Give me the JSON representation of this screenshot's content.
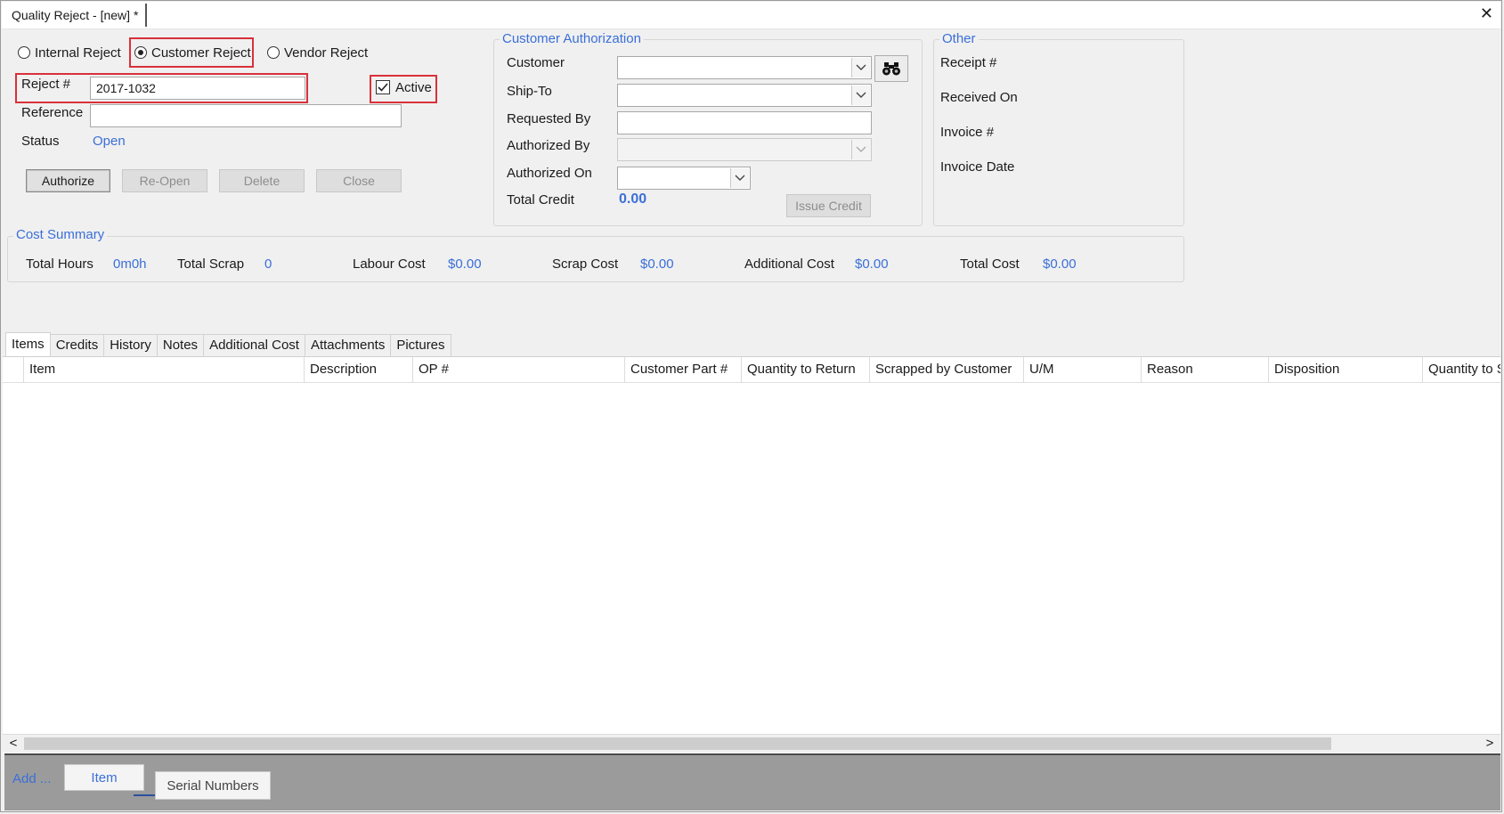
{
  "window": {
    "tab_title": "Quality Reject - [new] *",
    "close_glyph": "✕"
  },
  "reject_type": {
    "options": [
      {
        "label": "Internal Reject",
        "selected": false
      },
      {
        "label": "Customer Reject",
        "selected": true
      },
      {
        "label": "Vendor Reject",
        "selected": false
      }
    ]
  },
  "header": {
    "reject_label": "Reject #",
    "reject_value": "2017-1032",
    "active_label": "Active",
    "active_checked": true,
    "reference_label": "Reference",
    "reference_value": "",
    "status_label": "Status",
    "status_value": "Open"
  },
  "actions": {
    "authorize": "Authorize",
    "reopen": "Re-Open",
    "delete": "Delete",
    "close": "Close"
  },
  "customer_auth": {
    "title": "Customer Authorization",
    "customer_label": "Customer",
    "customer_value": "",
    "ship_to_label": "Ship-To",
    "ship_to_value": "",
    "requested_by_label": "Requested By",
    "requested_by_value": "",
    "authorized_by_label": "Authorized By",
    "authorized_by_value": "",
    "authorized_on_label": "Authorized On",
    "authorized_on_value": "",
    "total_credit_label": "Total Credit",
    "total_credit_value": "0.00",
    "issue_credit": "Issue Credit",
    "search_icon": "binoculars-icon"
  },
  "other": {
    "title": "Other",
    "receipt_label": "Receipt #",
    "received_on_label": "Received On",
    "invoice_label": "Invoice #",
    "invoice_date_label": "Invoice Date"
  },
  "cost_summary": {
    "title": "Cost Summary",
    "total_hours_label": "Total Hours",
    "total_hours_value": "0m0h",
    "total_scrap_label": "Total Scrap",
    "total_scrap_value": "0",
    "labour_cost_label": "Labour Cost",
    "labour_cost_value": "$0.00",
    "scrap_cost_label": "Scrap Cost",
    "scrap_cost_value": "$0.00",
    "additional_cost_label": "Additional Cost",
    "additional_cost_value": "$0.00",
    "total_cost_label": "Total Cost",
    "total_cost_value": "$0.00"
  },
  "tabs": [
    "Items",
    "Credits",
    "History",
    "Notes",
    "Additional Cost",
    "Attachments",
    "Pictures"
  ],
  "grid": {
    "columns": [
      "Item",
      "Description",
      "OP #",
      "Customer Part #",
      "Quantity to Return",
      "Scrapped by Customer",
      "U/M",
      "Reason",
      "Disposition",
      "Quantity to S"
    ]
  },
  "scrollbar": {
    "left": "<",
    "right": ">"
  },
  "bottom": {
    "add_label": "Add ...",
    "item_button": "Item",
    "serial_button": "Serial Numbers"
  },
  "colors": {
    "accent": "#3b6fd8",
    "highlight": "#d9313a"
  }
}
